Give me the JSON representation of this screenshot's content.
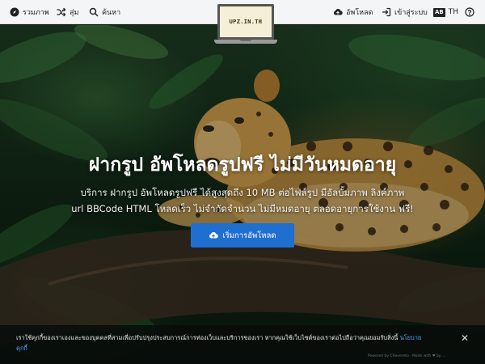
{
  "nav": {
    "gallery_label": "รวมภาพ",
    "random_label": "สุ่ม",
    "search_label": "ค้นหา",
    "upload_label": "อัพโหลด",
    "login_label": "เข้าสู่ระบบ",
    "language_icon_text": "AB",
    "language_label": "TH"
  },
  "logo": {
    "text": "UPZ.IN.TH"
  },
  "hero": {
    "headline": "ฝากรูป อัพโหลดรูปฟรี ไม่มีวันหมดอายุ",
    "subtext_line1": "บริการ ฝากรูป อัพโหลดรูปฟรี ได้สูงสุดถึง 10 MB ต่อไฟล์รูป มีอัลบั้มภาพ ลิงค์ภาพ",
    "subtext_line2": "url BBCode HTML โหลดเร็ว ไม่จำกัดจำนวน ไม่มีหมดอายุ ตลอดอายุการใช้งาน ฟรี!",
    "cta_label": "เริ่มการอัพโหลด"
  },
  "cookie": {
    "text": "เราใช้คุกกี้ของเราเองและของบุคคลที่สามเพื่อปรับปรุงประสบการณ์การท่องเว็บและบริการของเรา หากคุณใช้เว็บไซต์ของเราต่อไปถือว่าคุณยอมรับสิ่งนี้ ",
    "link_line1": "นโยบาย",
    "link_line2": "คุกกี้",
    "close_symbol": "✕"
  },
  "footer": {
    "powered": "Powered by Chevereto · Made with ❤ by ..."
  },
  "colors": {
    "accent": "#1f6fd1",
    "topbar_bg": "#f4f5f6",
    "link": "#5aa2ff"
  }
}
